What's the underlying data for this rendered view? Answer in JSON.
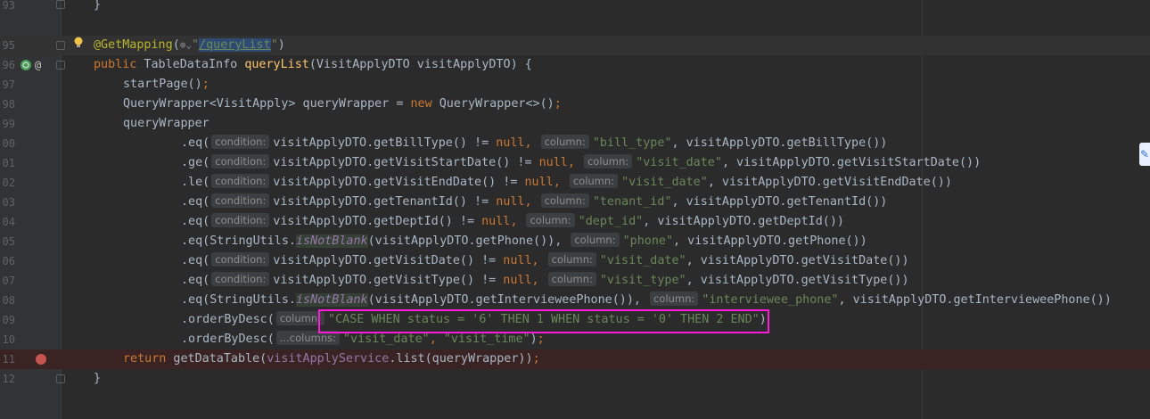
{
  "line_numbers": [
    "93",
    "",
    "95",
    "96",
    "97",
    "98",
    "99",
    "00",
    "01",
    "02",
    "03",
    "04",
    "05",
    "06",
    "07",
    "08",
    "09",
    "10",
    "11",
    "12"
  ],
  "code": {
    "l93_brace": "}",
    "l95_annotation": "@GetMapping",
    "l95_paren_open": "(",
    "l95_quote_open": "\"",
    "l95_path_slash": "/",
    "l95_path_name": "queryList",
    "l95_quote_close": "\"",
    "l95_paren_close": ")",
    "l96_public": "public",
    "l96_type": " TableDataInfo ",
    "l96_method": "queryList",
    "l96_params": "(VisitApplyDTO visitApplyDTO) {",
    "l97_call": "startPage()",
    "l97_semi": ";",
    "l98_decl": "QueryWrapper<VisitApply> queryWrapper = ",
    "l98_new": "new",
    "l98_rest": " QueryWrapper<>()",
    "l98_semi": ";",
    "l99_var": "queryWrapper",
    "l00_pre": ".eq(",
    "l00_hint1": "condition:",
    "l00_cond": "visitApplyDTO.getBillType() != ",
    "l00_null": "null",
    "l00_comma": ",",
    "l00_hint2": "column:",
    "l00_str": "\"bill_type\"",
    "l00_rest": ", visitApplyDTO.getBillType())",
    "l01_pre": ".ge(",
    "l01_hint1": "condition:",
    "l01_cond": "visitApplyDTO.getVisitStartDate() != ",
    "l01_null": "null",
    "l01_comma": ",",
    "l01_hint2": "column:",
    "l01_str": "\"visit_date\"",
    "l01_rest": ", visitApplyDTO.getVisitStartDate())",
    "l02_pre": ".le(",
    "l02_hint1": "condition:",
    "l02_cond": "visitApplyDTO.getVisitEndDate() != ",
    "l02_null": "null",
    "l02_comma": ",",
    "l02_hint2": "column:",
    "l02_str": "\"visit_date\"",
    "l02_rest": ", visitApplyDTO.getVisitEndDate())",
    "l03_pre": ".eq(",
    "l03_hint1": "condition:",
    "l03_cond": "visitApplyDTO.getTenantId() != ",
    "l03_null": "null",
    "l03_comma": ",",
    "l03_hint2": "column:",
    "l03_str": "\"tenant_id\"",
    "l03_rest": ", visitApplyDTO.getTenantId())",
    "l04_pre": ".eq(",
    "l04_hint1": "condition:",
    "l04_cond": "visitApplyDTO.getDeptId() != ",
    "l04_null": "null",
    "l04_comma": ",",
    "l04_hint2": "column:",
    "l04_str": "\"dept_id\"",
    "l04_rest": ", visitApplyDTO.getDeptId())",
    "l05_pre": ".eq(StringUtils.",
    "l05_static": "isNotBlank",
    "l05_mid": "(visitApplyDTO.getPhone()),",
    "l05_hint2": "column:",
    "l05_str": "\"phone\"",
    "l05_rest": ", visitApplyDTO.getPhone())",
    "l06_pre": ".eq(",
    "l06_hint1": "condition:",
    "l06_cond": "visitApplyDTO.getVisitDate() != ",
    "l06_null": "null",
    "l06_comma": ",",
    "l06_hint2": "column:",
    "l06_str": "\"visit_date\"",
    "l06_rest": ", visitApplyDTO.getVisitDate())",
    "l07_pre": ".eq(",
    "l07_hint1": "condition:",
    "l07_cond": "visitApplyDTO.getVisitType() != ",
    "l07_null": "null",
    "l07_comma": ",",
    "l07_hint2": "column:",
    "l07_str": "\"visit_type\"",
    "l07_rest": ", visitApplyDTO.getVisitType())",
    "l08_pre": ".eq(StringUtils.",
    "l08_static": "isNotBlank",
    "l08_mid": "(visitApplyDTO.getIntervieweePhone()),",
    "l08_hint2": "column:",
    "l08_str": "\"interviewee_phone\"",
    "l08_rest": ", visitApplyDTO.getIntervieweePhone())",
    "l09_pre": ".orderByDesc(",
    "l09_hint": "column:",
    "l09_str": "\"CASE WHEN status = '6' THEN 1 WHEN status = '0' THEN 2 END\"",
    "l09_close": ")",
    "l10_pre": ".orderByDesc(",
    "l10_hint": "...columns:",
    "l10_str1": "\"visit_date\"",
    "l10_comma": ", ",
    "l10_str2": "\"visit_time\"",
    "l10_close": ")",
    "l10_semi": ";",
    "l11_return": "return",
    "l11_mid": " getDataTable(",
    "l11_field": "visitApplyService",
    "l11_rest": ".list(queryWrapper))",
    "l11_semi": ";",
    "l12_brace": "}"
  },
  "icons": {
    "bulb": "lightbulb-icon",
    "web": "web-endpoint-icon",
    "at": "annotation-icon",
    "breakpoint": "breakpoint-icon",
    "side": "side-plugin-icon"
  },
  "colors": {
    "background": "#2b2b2b",
    "keyword": "#cc7832",
    "string": "#6a8759",
    "method_decl": "#ffc66d",
    "annotation": "#bbb529",
    "highlight_box": "#ff19d9"
  }
}
